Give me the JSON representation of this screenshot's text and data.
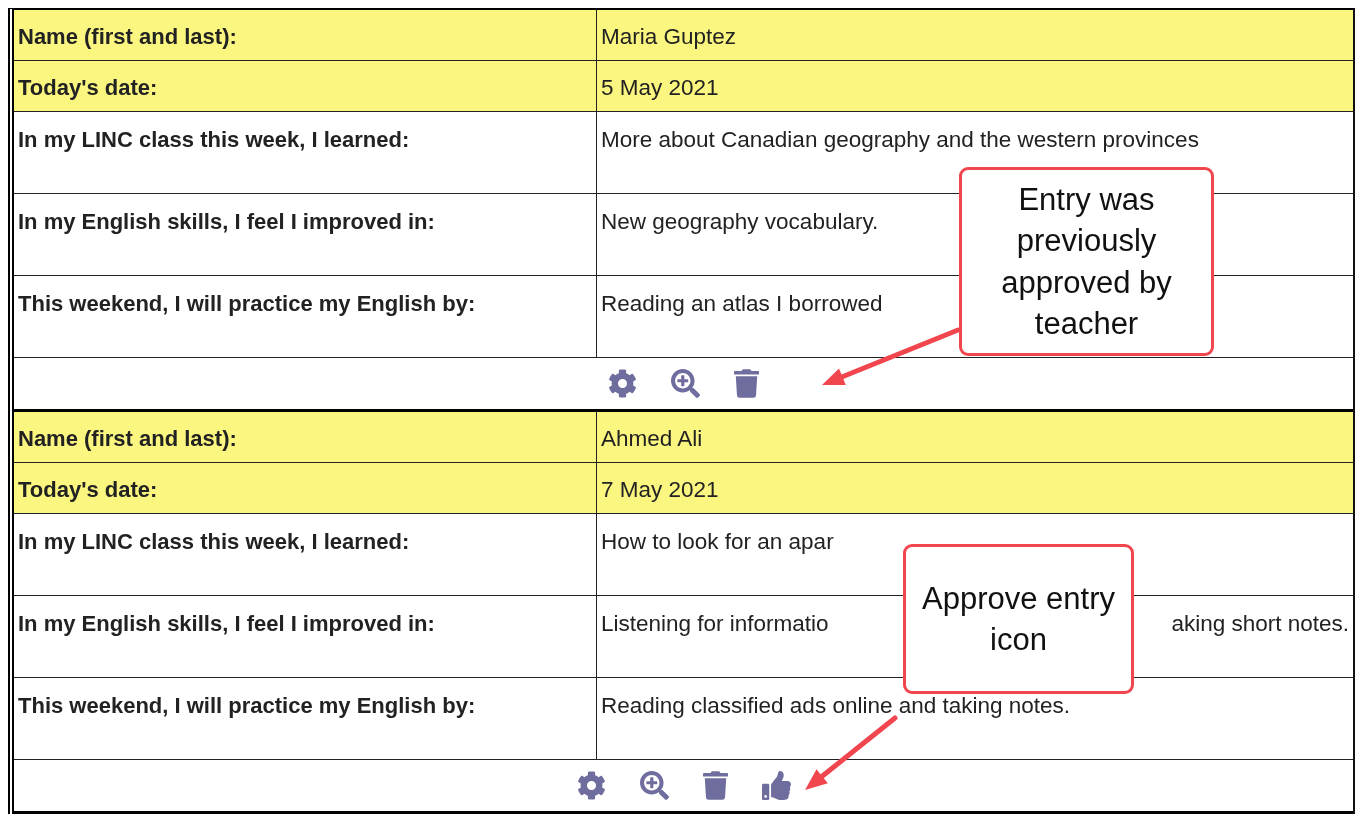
{
  "entries": [
    {
      "fields": [
        {
          "kind": "header",
          "label": "Name (first and last):",
          "value": "Maria Guptez"
        },
        {
          "kind": "header",
          "label": "Today's date:",
          "value": "5 May 2021"
        },
        {
          "kind": "answer",
          "label": "In my LINC class this week, I learned:",
          "value": "More about Canadian geography and the western provinces"
        },
        {
          "kind": "answer",
          "label": "In my English skills, I feel I improved in:",
          "value": "New geography vocabulary."
        },
        {
          "kind": "answer",
          "label": "This weekend, I will practice my English by:",
          "value": "Reading an atlas I borrowed"
        }
      ],
      "actions": [
        {
          "kind": "settings"
        },
        {
          "kind": "view"
        },
        {
          "kind": "delete"
        }
      ]
    },
    {
      "fields": [
        {
          "kind": "header",
          "label": "Name (first and last):",
          "value": "Ahmed Ali"
        },
        {
          "kind": "header",
          "label": "Today's date:",
          "value": "7 May 2021"
        },
        {
          "kind": "answer",
          "label": "In my LINC class this week, I learned:",
          "value": "How to look for an apar"
        },
        {
          "kind": "answer",
          "label": "In my English skills, I feel I improved in:",
          "value": "Listening for informatio",
          "value_end": "aking short notes."
        },
        {
          "kind": "answer",
          "label": "This weekend, I will practice my English by:",
          "value": "Reading classified ads online and taking notes."
        }
      ],
      "actions": [
        {
          "kind": "settings"
        },
        {
          "kind": "view"
        },
        {
          "kind": "delete"
        },
        {
          "kind": "approve"
        }
      ]
    }
  ],
  "callouts": [
    {
      "text": "Entry was previously approved by teacher"
    },
    {
      "text": "Approve entry icon"
    }
  ]
}
